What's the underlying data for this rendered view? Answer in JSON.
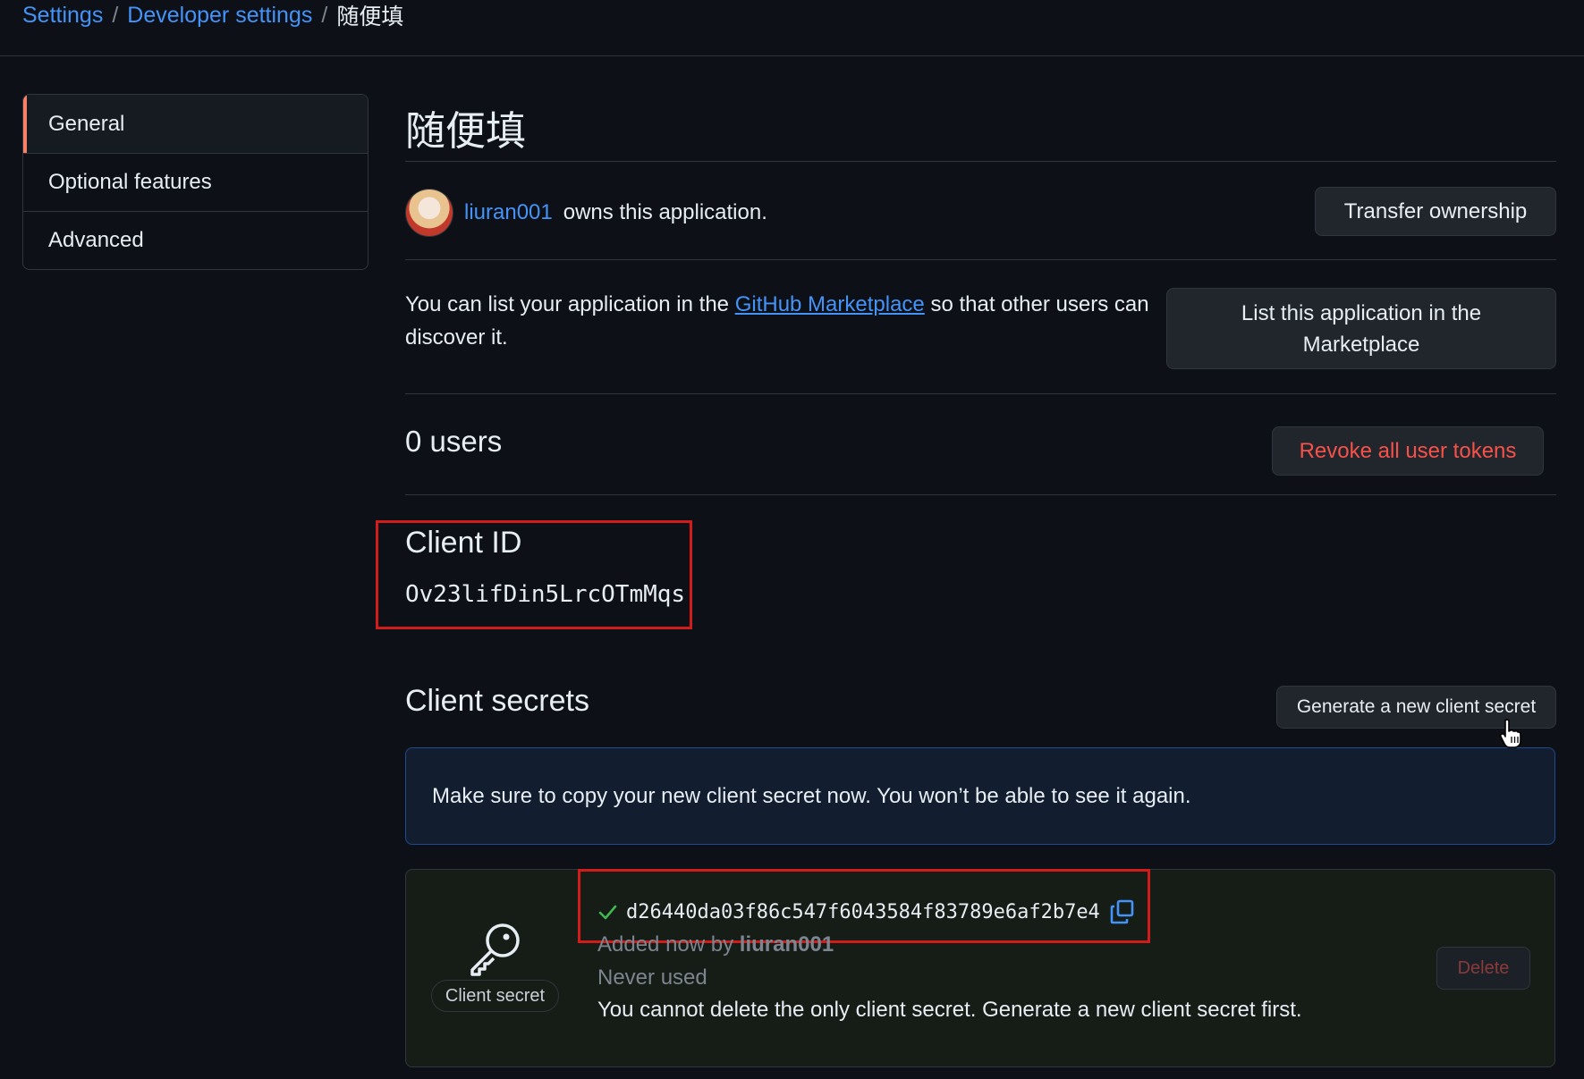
{
  "breadcrumb": {
    "items": [
      "Settings",
      "Developer settings"
    ],
    "separator": "/",
    "current": "随便填"
  },
  "sidebar": {
    "items": [
      {
        "label": "General",
        "selected": true
      },
      {
        "label": "Optional features",
        "selected": false
      },
      {
        "label": "Advanced",
        "selected": false
      }
    ]
  },
  "app": {
    "title": "随便填",
    "owner": "liuran001",
    "owner_suffix": "owns this application.",
    "transfer_label": "Transfer ownership",
    "marketplace_text_before": "You can list your application in the",
    "marketplace_link": "GitHub Marketplace",
    "marketplace_text_after": "so that other users can discover it.",
    "list_button_label": "List this application in the Marketplace",
    "users_count": "0 users",
    "revoke_label": "Revoke all user tokens",
    "client_id_label": "Client ID",
    "client_id": "Ov23lifDin5LrcOTmMqs",
    "client_secrets_heading": "Client secrets",
    "generate_secret_label": "Generate a new client secret",
    "flash_message": "Make sure to copy your new client secret now. You won’t be able to see it again.",
    "secret": {
      "badge": "Client secret",
      "value": "d26440da03f86c547f6043584f83789e6af2b7e4",
      "added_prefix": "Added now by",
      "added_by": "liuran001",
      "usage": "Never used",
      "note": "You cannot delete the only client secret. Generate a new client secret first.",
      "delete_label": "Delete"
    }
  },
  "colors": {
    "background": "#0d1117",
    "link": "#4493f8",
    "danger": "#f85149",
    "highlight_border": "#d21c1c",
    "selected_accent": "#f78166"
  }
}
